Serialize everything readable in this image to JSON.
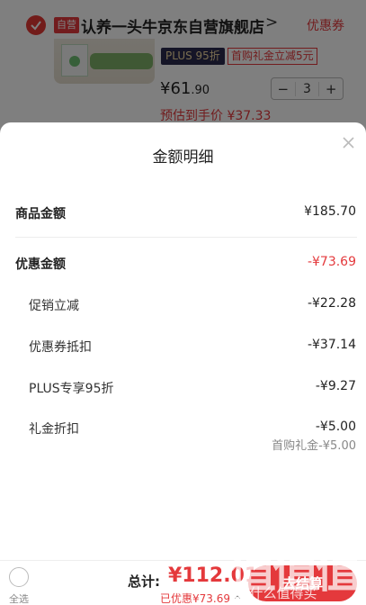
{
  "cart": {
    "self_tag": "自营",
    "store_name": "认养一头牛京东自营旗舰店",
    "store_arrow": ">",
    "coupon_link": "优惠券",
    "plus_badge": "PLUS 95折",
    "gift_tag": "首购礼金立减5元",
    "unit_price_main": "¥61",
    "unit_price_dec": ".90",
    "quantity": "3",
    "minus": "−",
    "plus": "+",
    "estimate": "预估到手价 ¥37.33"
  },
  "sheet": {
    "title": "金额明细",
    "close": "×",
    "rows": [
      {
        "label": "商品金额",
        "value": "¥185.70"
      },
      {
        "label": "优惠金额",
        "value": "-¥73.69"
      },
      {
        "label": "促销立减",
        "value": "-¥22.28"
      },
      {
        "label": "优惠券抵扣",
        "value": "-¥37.14"
      },
      {
        "label": "PLUS专享95折",
        "value": "-¥9.27"
      },
      {
        "label": "礼金折扣",
        "value": "-¥5.00"
      }
    ],
    "gift_note": "首购礼金-¥5.00"
  },
  "bottom": {
    "select_all": "全选",
    "total_label": "总计:",
    "total_value": "¥112.01",
    "saved": "已优惠¥73.69",
    "saved_arrow": "^",
    "checkout": "去结算"
  },
  "watermark": {
    "main": "值值值",
    "sub": "zhi什么值得买"
  },
  "colors": {
    "accent": "#e4393c",
    "plus_badge_bg": "#2b2b4f"
  }
}
